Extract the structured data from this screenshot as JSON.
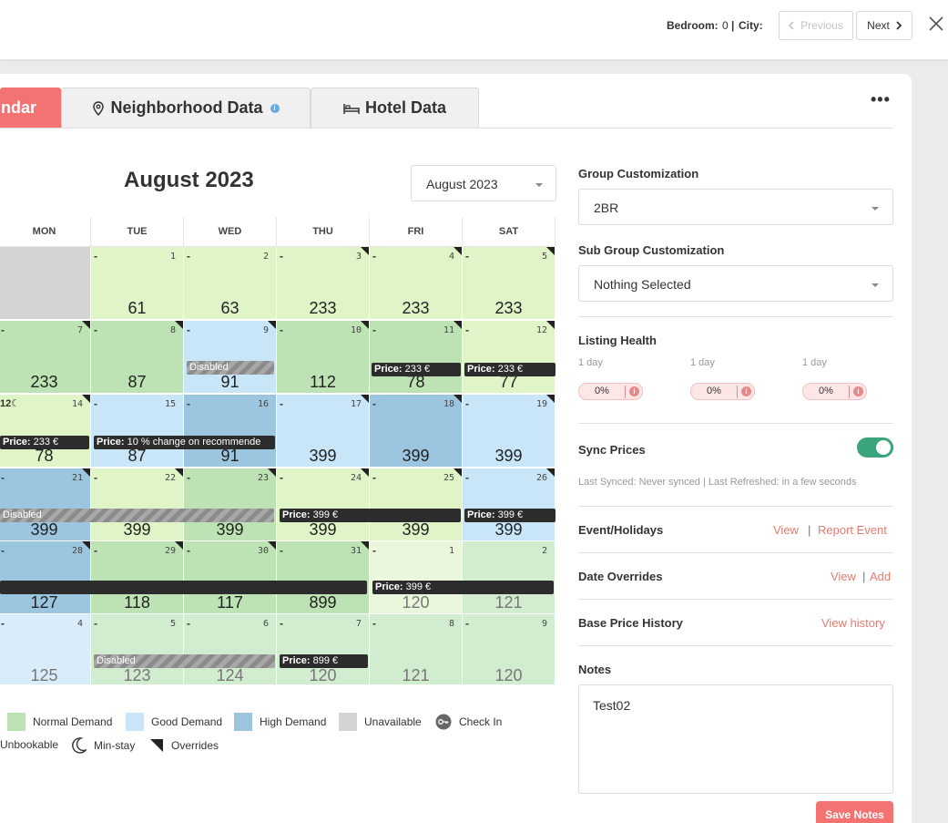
{
  "topbar": {
    "bedroom_label": "Bedroom:",
    "bedroom_value": "0",
    "separator": "|",
    "city_label": "City:",
    "previous_label": "Previous",
    "next_label": "Next"
  },
  "tabs": [
    {
      "label": "ndar",
      "active": true
    },
    {
      "label": "Neighborhood Data",
      "active": false
    },
    {
      "label": "Hotel Data",
      "active": false
    }
  ],
  "more_menu": "•••",
  "calendar": {
    "title": "August 2023",
    "month_select": "August 2023",
    "weekdays": [
      "MON",
      "TUE",
      "WED",
      "THU",
      "FRI",
      "SAT"
    ],
    "rows": [
      [
        {
          "day": "",
          "price": "",
          "color": "unavail",
          "dash": false,
          "corner": false
        },
        {
          "day": "1",
          "price": "61",
          "color": "light",
          "dash": true,
          "corner": false
        },
        {
          "day": "2",
          "price": "63",
          "color": "light",
          "dash": true,
          "corner": false
        },
        {
          "day": "3",
          "price": "233",
          "color": "light",
          "dash": true,
          "corner": true
        },
        {
          "day": "4",
          "price": "233",
          "color": "light",
          "dash": true,
          "corner": true
        },
        {
          "day": "5",
          "price": "233",
          "color": "light",
          "dash": true,
          "corner": true
        }
      ],
      [
        {
          "day": "7",
          "price": "233",
          "color": "normal",
          "dash": true,
          "corner": true
        },
        {
          "day": "8",
          "price": "87",
          "color": "normal",
          "dash": true,
          "corner": true
        },
        {
          "day": "9",
          "price": "91",
          "color": "good",
          "dash": true,
          "corner": true
        },
        {
          "day": "10",
          "price": "112",
          "color": "normal",
          "dash": true,
          "corner": true
        },
        {
          "day": "11",
          "price": "78",
          "color": "normal",
          "dash": true,
          "corner": true
        },
        {
          "day": "12",
          "price": "77",
          "color": "light",
          "dash": true,
          "corner": true
        }
      ],
      [
        {
          "day": "14",
          "price": "78",
          "color": "light",
          "dash": false,
          "corner": true
        },
        {
          "day": "15",
          "price": "87",
          "color": "good",
          "dash": true,
          "corner": false
        },
        {
          "day": "16",
          "price": "91",
          "color": "high",
          "dash": true,
          "corner": false
        },
        {
          "day": "17",
          "price": "399",
          "color": "good",
          "dash": true,
          "corner": true
        },
        {
          "day": "18",
          "price": "399",
          "color": "high",
          "dash": true,
          "corner": true
        },
        {
          "day": "19",
          "price": "399",
          "color": "good",
          "dash": true,
          "corner": true
        }
      ],
      [
        {
          "day": "21",
          "price": "399",
          "color": "high",
          "dash": true,
          "corner": true
        },
        {
          "day": "22",
          "price": "399",
          "color": "light",
          "dash": true,
          "corner": true
        },
        {
          "day": "23",
          "price": "399",
          "color": "normal",
          "dash": true,
          "corner": true
        },
        {
          "day": "24",
          "price": "399",
          "color": "light",
          "dash": true,
          "corner": true
        },
        {
          "day": "25",
          "price": "399",
          "color": "light",
          "dash": true,
          "corner": true
        },
        {
          "day": "26",
          "price": "399",
          "color": "good",
          "dash": true,
          "corner": true
        }
      ],
      [
        {
          "day": "28",
          "price": "127",
          "color": "high",
          "dash": true,
          "corner": true
        },
        {
          "day": "29",
          "price": "118",
          "color": "normal",
          "dash": true,
          "corner": true
        },
        {
          "day": "30",
          "price": "117",
          "color": "normal",
          "dash": true,
          "corner": true
        },
        {
          "day": "31",
          "price": "899",
          "color": "normal",
          "dash": true,
          "corner": true
        },
        {
          "day": "1",
          "price": "120",
          "color": "fade1",
          "dash": true,
          "corner": false,
          "faded": true
        },
        {
          "day": "2",
          "price": "121",
          "color": "fade2",
          "dash": false,
          "corner": false,
          "faded": true
        }
      ],
      [
        {
          "day": "4",
          "price": "125",
          "color": "fade3",
          "dash": true,
          "corner": false,
          "faded": true
        },
        {
          "day": "5",
          "price": "123",
          "color": "fade2",
          "dash": true,
          "corner": false,
          "faded": true
        },
        {
          "day": "6",
          "price": "124",
          "color": "fade2",
          "dash": true,
          "corner": false,
          "faded": true
        },
        {
          "day": "7",
          "price": "120",
          "color": "fade2",
          "dash": true,
          "corner": false,
          "faded": true
        },
        {
          "day": "8",
          "price": "121",
          "color": "fade2",
          "dash": true,
          "corner": false,
          "faded": true
        },
        {
          "day": "9",
          "price": "120",
          "color": "fade2",
          "dash": true,
          "corner": false,
          "faded": true
        }
      ]
    ],
    "overlay_labels": {
      "disabled": "Disabled",
      "price_prefix": "Price:",
      "price_233": "233 €",
      "price_399": "399 €",
      "price_899": "899 €",
      "price_10pct": "10 % change on recommende",
      "row3_min_stay": "12",
      "moon": "☾"
    }
  },
  "legend": [
    {
      "label": "Normal Demand",
      "color": "#bde3b5"
    },
    {
      "label": "Good Demand",
      "color": "#c8e6f8"
    },
    {
      "label": "High Demand",
      "color": "#9cc6df"
    },
    {
      "label": "Unavailable",
      "color": "#d4d4d4"
    },
    {
      "label": "Check In",
      "icon": "key-icon"
    },
    {
      "label": "Unbookable"
    },
    {
      "label": "Min-stay",
      "icon": "moon-icon"
    },
    {
      "label": "Overrides",
      "icon": "corner-triangle-icon"
    }
  ],
  "right": {
    "group_label": "Group Customization",
    "group_value": "2BR",
    "subgroup_label": "Sub Group Customization",
    "subgroup_value": "Nothing Selected",
    "health_label": "Listing Health",
    "health_items": [
      {
        "period": "1 day",
        "value": "0%"
      },
      {
        "period": "1 day",
        "value": "0%"
      },
      {
        "period": "1 day",
        "value": "0%"
      }
    ],
    "sync_label": "Sync Prices",
    "sync_on": true,
    "sync_status": "Last Synced: Never synced | Last Refreshed: in a few seconds",
    "events_label": "Event/Holidays",
    "events_view": "View",
    "events_sep": "|",
    "events_report": "Report Event",
    "overrides_label": "Date Overrides",
    "overrides_view": "View",
    "overrides_sep": "|",
    "overrides_add": "Add",
    "history_label": "Base Price History",
    "history_link": "View history",
    "notes_label": "Notes",
    "notes_value": "Test02",
    "save_label": "Save Notes"
  },
  "colors": {
    "accent": "#f27372",
    "link": "#e77b6f",
    "toggle": "#3aa47a"
  }
}
